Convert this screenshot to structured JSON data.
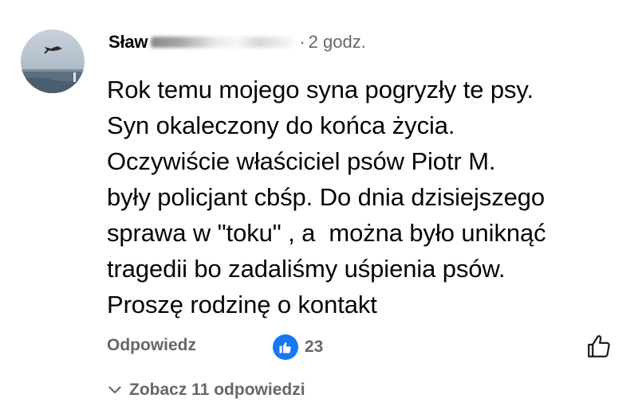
{
  "comment": {
    "author_name": "Sław",
    "timestamp_separator": "·",
    "timestamp": "2 godz.",
    "body_lines": [
      "Rok temu mojego syna pogryzły te psy.",
      "Syn okaleczony do końca życia.",
      "Oczywiście właściciel psów Piotr M.",
      "były policjant cbśp. Do dnia dzisiejszego",
      "sprawa w \"toku\" , a  można było uniknąć",
      "tragedii bo zadaliśmy uśpienia psów.",
      "Proszę rodzinę o kontakt"
    ],
    "reply_label": "Odpowiedz",
    "reaction_count": "23",
    "view_replies_label": "Zobacz 11 odpowiedzi"
  },
  "icons": {
    "reaction_badge": "like-thumb-icon",
    "like_action": "thumbs-up-outline-icon",
    "view_replies": "chevron-down-icon"
  },
  "colors": {
    "text_primary": "#050505",
    "text_secondary": "#65676b",
    "like_blue": "#1877f2",
    "background": "#ffffff"
  }
}
